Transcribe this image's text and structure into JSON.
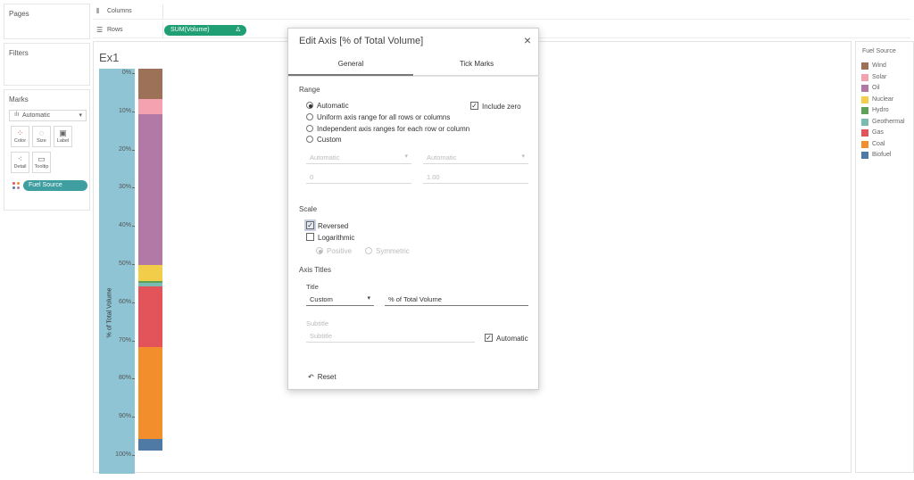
{
  "left_pane": {
    "pages_title": "Pages",
    "filters_title": "Filters",
    "marks_title": "Marks",
    "mark_type": "Automatic",
    "mark_buttons": [
      {
        "label": "Color",
        "icon": "color-dots-icon"
      },
      {
        "label": "Size",
        "icon": "size-icon"
      },
      {
        "label": "Label",
        "icon": "label-icon"
      },
      {
        "label": "Detail",
        "icon": "detail-icon"
      },
      {
        "label": "Tooltip",
        "icon": "tooltip-icon"
      }
    ],
    "color_pill": "Fuel Source"
  },
  "shelves": {
    "columns_label": "Columns",
    "rows_label": "Rows",
    "rows_pill": "SUM(Volume)",
    "rows_pill_delta": "Δ"
  },
  "viz": {
    "title": "Ex1",
    "axis_title": "% of Total Volume",
    "ticks": [
      "0%",
      "10%",
      "20%",
      "30%",
      "40%",
      "50%",
      "60%",
      "70%",
      "80%",
      "90%",
      "100%"
    ],
    "axis_color": "#8ec4d4"
  },
  "chart_data": {
    "type": "bar",
    "orientation": "vertical-stacked",
    "axis_reversed": true,
    "ylabel": "% of Total Volume",
    "ylim": [
      0,
      100
    ],
    "series": [
      {
        "name": "Wind",
        "value": 8,
        "color": "#9c7158"
      },
      {
        "name": "Solar",
        "value": 4,
        "color": "#f4a1b0"
      },
      {
        "name": "Oil",
        "value": 39.5,
        "color": "#b278a6"
      },
      {
        "name": "Nuclear",
        "value": 4,
        "color": "#f2cd4a"
      },
      {
        "name": "Hydro",
        "value": 0.5,
        "color": "#5ea257"
      },
      {
        "name": "Geothermal",
        "value": 1,
        "color": "#7bbcb2"
      },
      {
        "name": "Gas",
        "value": 16,
        "color": "#e3545a"
      },
      {
        "name": "Coal",
        "value": 24,
        "color": "#f28e2c"
      },
      {
        "name": "Biofuel",
        "value": 3,
        "color": "#4f7aa6"
      }
    ]
  },
  "legend": {
    "title": "Fuel Source",
    "items": [
      {
        "label": "Wind",
        "color": "#9c7158"
      },
      {
        "label": "Solar",
        "color": "#f4a1b0"
      },
      {
        "label": "Oil",
        "color": "#b278a6"
      },
      {
        "label": "Nuclear",
        "color": "#f2cd4a"
      },
      {
        "label": "Hydro",
        "color": "#5ea257"
      },
      {
        "label": "Geothermal",
        "color": "#7bbcb2"
      },
      {
        "label": "Gas",
        "color": "#e3545a"
      },
      {
        "label": "Coal",
        "color": "#f28e2c"
      },
      {
        "label": "Biofuel",
        "color": "#4f7aa6"
      }
    ]
  },
  "dialog": {
    "title": "Edit Axis [% of Total Volume]",
    "close": "×",
    "tabs": [
      "General",
      "Tick Marks"
    ],
    "active_tab": "General",
    "range": {
      "title": "Range",
      "options": [
        "Automatic",
        "Uniform axis range for all rows or columns",
        "Independent axis ranges for each row or column",
        "Custom"
      ],
      "selected": "Automatic",
      "include_zero_label": "Include zero",
      "include_zero_checked": true,
      "start_mode": "Automatic",
      "end_mode": "Automatic",
      "start_value": "0",
      "end_value": "1.00"
    },
    "scale": {
      "title": "Scale",
      "reversed_label": "Reversed",
      "reversed_checked": true,
      "log_label": "Logarithmic",
      "log_checked": false,
      "positive_label": "Positive",
      "symmetric_label": "Symmetric"
    },
    "axis_titles": {
      "title": "Axis Titles",
      "title_label": "Title",
      "title_mode": "Custom",
      "title_value": "% of Total Volume",
      "subtitle_label": "Subtitle",
      "subtitle_placeholder": "Subtitle",
      "automatic_label": "Automatic",
      "automatic_checked": true
    },
    "reset_label": "Reset"
  }
}
